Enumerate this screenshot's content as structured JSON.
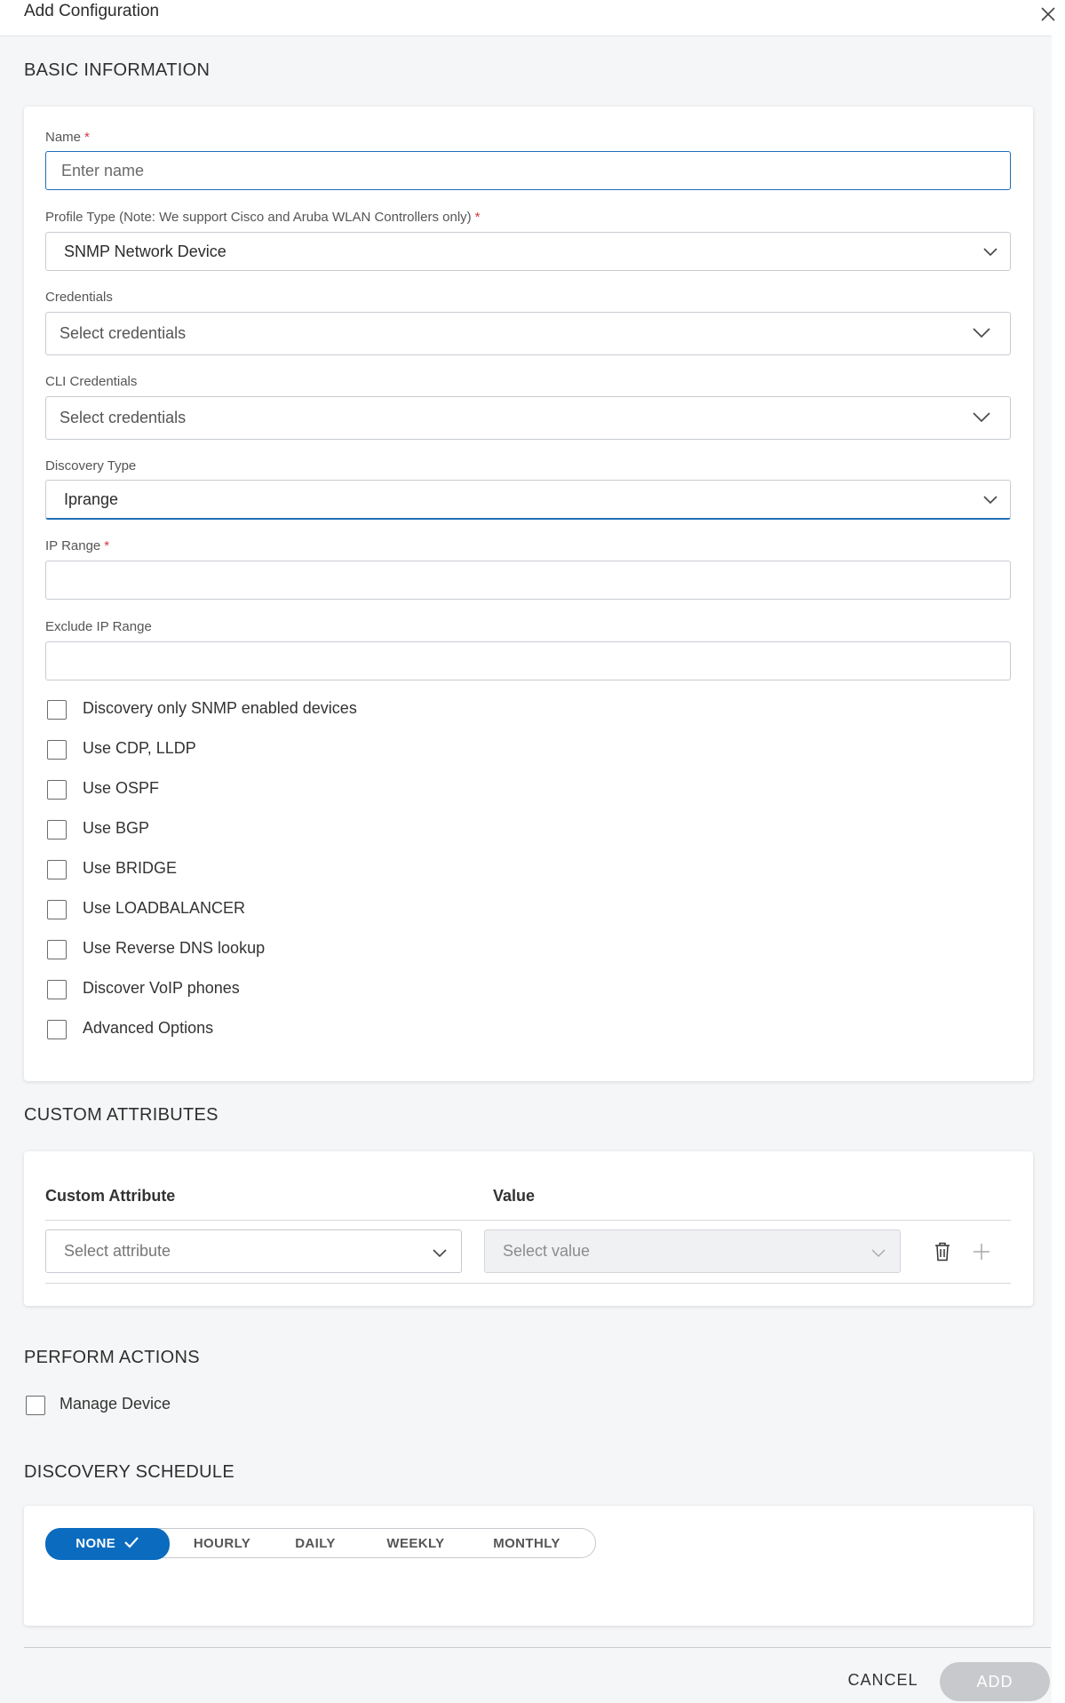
{
  "dialog": {
    "title": "Add Configuration"
  },
  "basic_info": {
    "section_title": "BASIC INFORMATION",
    "name": {
      "label": "Name",
      "required_mark": "*",
      "placeholder": "Enter name",
      "value": ""
    },
    "profile_type": {
      "label": "Profile Type (Note: We support Cisco and Aruba WLAN Controllers only)",
      "required_mark": "*",
      "value": "SNMP Network Device"
    },
    "credentials": {
      "label": "Credentials",
      "placeholder": "Select credentials"
    },
    "cli_credentials": {
      "label": "CLI Credentials",
      "placeholder": "Select credentials"
    },
    "discovery_type": {
      "label": "Discovery Type",
      "value": "Iprange"
    },
    "ip_range": {
      "label": "IP Range",
      "required_mark": "*",
      "value": ""
    },
    "exclude_ip_range": {
      "label": "Exclude IP Range",
      "value": ""
    },
    "options": [
      {
        "label": "Discovery only SNMP enabled devices",
        "checked": false
      },
      {
        "label": "Use CDP, LLDP",
        "checked": false
      },
      {
        "label": "Use OSPF",
        "checked": false
      },
      {
        "label": "Use BGP",
        "checked": false
      },
      {
        "label": "Use BRIDGE",
        "checked": false
      },
      {
        "label": "Use LOADBALANCER",
        "checked": false
      },
      {
        "label": "Use Reverse DNS lookup",
        "checked": false
      },
      {
        "label": "Discover VoIP phones",
        "checked": false
      },
      {
        "label": "Advanced Options",
        "checked": false
      }
    ]
  },
  "custom_attributes": {
    "section_title": "CUSTOM ATTRIBUTES",
    "col_attribute": "Custom Attribute",
    "col_value": "Value",
    "attribute_placeholder": "Select attribute",
    "value_placeholder": "Select value",
    "icons": {
      "delete": "trash-icon",
      "add": "plus-icon"
    }
  },
  "perform_actions": {
    "section_title": "PERFORM ACTIONS",
    "manage_device": {
      "label": "Manage Device",
      "checked": false
    }
  },
  "discovery_schedule": {
    "section_title": "DISCOVERY SCHEDULE",
    "options": [
      "NONE",
      "HOURLY",
      "DAILY",
      "WEEKLY",
      "MONTHLY"
    ],
    "selected": "NONE"
  },
  "footer": {
    "cancel_label": "CANCEL",
    "add_label": "ADD"
  },
  "colors": {
    "accent": "#0a6bbf",
    "required": "#d9363e",
    "disabled_button": "#c7c9cc"
  }
}
